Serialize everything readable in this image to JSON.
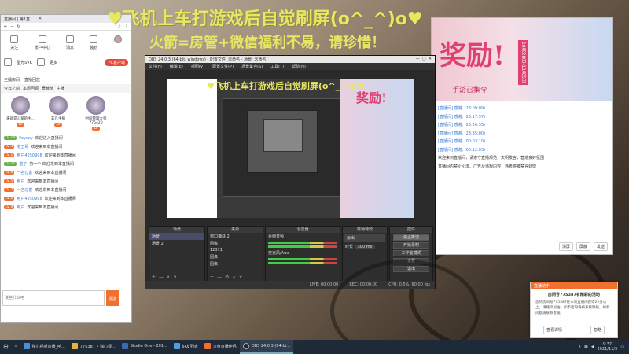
{
  "overlay": {
    "line1": "♥飞机上车打游戏后自觉刷屏(o^_^)o♥",
    "line2": "火箭=房管+微信福利不易，请珍惜！",
    "heart": "♥ ♥"
  },
  "browser": {
    "tab_title": "直播间 | 第1直...",
    "icons": [
      {
        "label": "关注",
        "icon": "heart-icon"
      },
      {
        "label": "账户中心",
        "icon": "user-icon"
      },
      {
        "label": "消息",
        "icon": "bell-icon"
      },
      {
        "label": "装扮",
        "icon": "shirt-icon"
      }
    ],
    "row2": [
      "星光SVK",
      "更多"
    ],
    "pc_button": "PC客户端",
    "room_label": "主播房间",
    "gift_label": "直播回放",
    "tabs": [
      "今日之前",
      "本周回顾",
      "贡献榜",
      "主播"
    ],
    "top_users": [
      {
        "name": "来就是心爱的主...",
        "badge": "LV"
      },
      {
        "name": "非凡主播",
        "badge": "LV"
      },
      {
        "name": "时间管理大师775420",
        "badge": "LV"
      }
    ],
    "chat": [
      {
        "lv": "LV 10",
        "name": "Feyxxy",
        "text": "欢迎进入直播间"
      },
      {
        "lv": "LV 3",
        "name": "老王哥",
        "text": "欢迎来到本直播间"
      },
      {
        "lv": "LV 1",
        "name": "用户4250998",
        "text": "欢迎来到本直播间"
      },
      {
        "lv": "LV 11",
        "name": "送了",
        "text": "第一个 欢迎来到本直播间"
      },
      {
        "lv": "LV 8",
        "name": "一名过客",
        "text": "欢迎来到本直播间"
      },
      {
        "lv": "LV 5",
        "name": "用户",
        "text": "欢迎来到本直播间"
      },
      {
        "lv": "LV 7",
        "name": "一名过客",
        "text": "欢迎来到本直播间"
      },
      {
        "lv": "LV 2",
        "name": "用户4250998",
        "text": "欢迎来到本直播间"
      },
      {
        "lv": "LV 9",
        "name": "用户",
        "text": "欢迎来到本直播间"
      }
    ],
    "input_placeholder": "说些什么吧",
    "send_label": "发送"
  },
  "room": {
    "banner_big": "奖励!",
    "banner_small": "手游召集令",
    "banner_badge": "10月28日-11月5日",
    "messages": [
      {
        "sys": true,
        "text": "[直播间] 感谢, (23:09:09)"
      },
      {
        "sys": true,
        "text": "[直播间] 感谢, (23:17:57)"
      },
      {
        "sys": true,
        "text": "[直播间] 感谢, (23:26:55)"
      },
      {
        "sys": true,
        "text": "[直播间] 感谢, (23:35:00)"
      },
      {
        "sys": true,
        "text": "[直播间] 感谢, (00:03:10)"
      },
      {
        "sys": true,
        "text": "[直播间] 感谢, (00:12:03)"
      },
      {
        "sys": false,
        "text": "欢迎来到直播间，请遵守直播规范，文明发言，营造良好氛围"
      },
      {
        "sys": false,
        "text": "直播间内禁止引流、广告及违规内容，违者将被禁言处理"
      }
    ],
    "foot_buttons": [
      "清屏",
      "屏蔽",
      "发送"
    ]
  },
  "obs": {
    "title": "OBS 24.0.3 (64-bit, windows) - 配置文件: 未命名 - 场景: 未命名",
    "menu": [
      "文件(F)",
      "编辑(E)",
      "视图(V)",
      "配置文件(P)",
      "场景集合(S)",
      "工具(T)",
      "帮助(H)"
    ],
    "docks": {
      "scenes": {
        "title": "场景",
        "items": [
          "场景",
          "场景 2"
        ]
      },
      "sources": {
        "title": "来源",
        "items": [
          "窗口捕获 2",
          "图像",
          "12311",
          "图像",
          "图像"
        ]
      },
      "mixer": {
        "title": "混音器",
        "items": [
          "桌面音频",
          "麦克风/Aux"
        ]
      },
      "transitions": {
        "title": "转场特效",
        "fade": "淡出",
        "duration_label": "时长",
        "duration": "300 ms"
      },
      "controls": {
        "title": "控件",
        "buttons": [
          "停止推流",
          "开始录制",
          "工作室模式",
          "设置",
          "退出"
        ]
      }
    },
    "status": {
      "live": "LIVE: 00:00:00",
      "rec": "REC: 00:00:00",
      "cpu": "CPU: 0.5%, 60.00 fps"
    }
  },
  "notification": {
    "header": "直播助手",
    "title": "房间号775387有精彩的活动",
    "body": "您的房间号775387在本周直播间获得22分以上，请继续加油！如不出现将被系统降级，如有问题请联系客服。",
    "buttons": [
      "查看详情",
      "忽略"
    ]
  },
  "taskbar": {
    "items": [
      {
        "label": "独心视听直播_哈...",
        "icon": "browser-icon",
        "color": "#4a90d9",
        "active": false
      },
      {
        "label": "775387 • 独心视...",
        "icon": "folder-icon",
        "color": "#e8b040",
        "active": false
      },
      {
        "label": "Studio One - 201...",
        "icon": "audio-icon",
        "color": "#3a6ab0",
        "active": false
      },
      {
        "label": "好友列表",
        "icon": "chat-icon",
        "color": "#4aa0e0",
        "active": false
      },
      {
        "label": "斗鱼直播伴侣",
        "icon": "douyu-icon",
        "color": "#f07030",
        "active": false
      },
      {
        "label": "OBS 24.0.3 (64-bi...",
        "icon": "obs-icon",
        "color": "#222",
        "active": true
      }
    ],
    "time": "9:37",
    "date": "2021/11/5"
  }
}
